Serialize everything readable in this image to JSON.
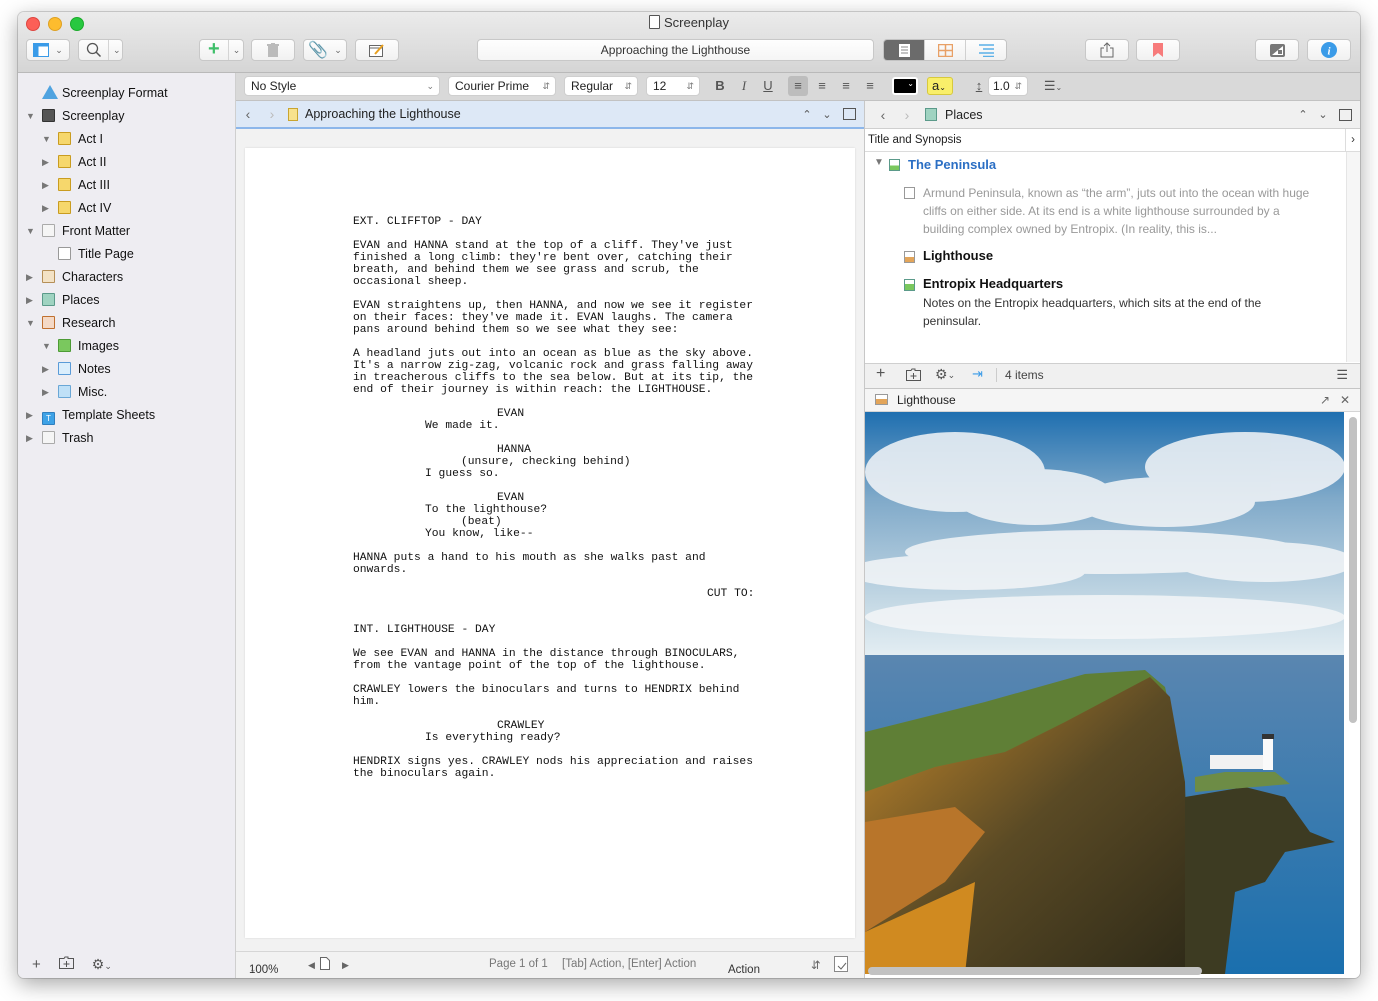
{
  "window": {
    "title": "Screenplay"
  },
  "toolbar": {
    "document_title": "Approaching the Lighthouse",
    "buttons": [
      "layout-button",
      "search-button",
      "add-button",
      "trash-button",
      "attach-button",
      "compose-button",
      "view-scrivenings",
      "view-corkboard",
      "view-outliner",
      "share-button",
      "bookmark-button",
      "compose-mode-button",
      "inspector-button"
    ],
    "colors": {
      "add": "#3fbf6a",
      "corkboard": "#e8a066",
      "outliner": "#5ab0e8",
      "bookmark": "#f77b7b",
      "inspector": "#3a9be8"
    }
  },
  "formatbar": {
    "style": "No Style",
    "font": "Courier Prime",
    "weight": "Regular",
    "size": "12",
    "bold": "B",
    "italic": "I",
    "underline": "U",
    "highlight_label": "a",
    "line_spacing": "1.0"
  },
  "binder": {
    "items": [
      {
        "label": "Screenplay Format",
        "level": 0,
        "icon": "warning-icon",
        "expander": "none"
      },
      {
        "label": "Screenplay",
        "level": 0,
        "icon": "screenplay-icon",
        "expander": "open"
      },
      {
        "label": "Act I",
        "level": 1,
        "icon": "book-icon",
        "expander": "open"
      },
      {
        "label": "Act II",
        "level": 1,
        "icon": "book-icon",
        "expander": "closed"
      },
      {
        "label": "Act III",
        "level": 1,
        "icon": "book-icon",
        "expander": "closed"
      },
      {
        "label": "Act IV",
        "level": 1,
        "icon": "book-icon",
        "expander": "closed"
      },
      {
        "label": "Front Matter",
        "level": 0,
        "icon": "front-matter-icon",
        "expander": "open"
      },
      {
        "label": "Title Page",
        "level": 1,
        "icon": "page-icon",
        "expander": "none"
      },
      {
        "label": "Characters",
        "level": 0,
        "icon": "characters-icon",
        "expander": "closed"
      },
      {
        "label": "Places",
        "level": 0,
        "icon": "places-icon",
        "expander": "closed"
      },
      {
        "label": "Research",
        "level": 0,
        "icon": "research-icon",
        "expander": "open"
      },
      {
        "label": "Images",
        "level": 1,
        "icon": "green-book-icon",
        "expander": "open"
      },
      {
        "label": "Notes",
        "level": 1,
        "icon": "notebook-icon",
        "expander": "closed"
      },
      {
        "label": "Misc.",
        "level": 1,
        "icon": "folder-icon",
        "expander": "closed"
      },
      {
        "label": "Template Sheets",
        "level": 0,
        "icon": "template-icon",
        "expander": "closed"
      },
      {
        "label": "Trash",
        "level": 0,
        "icon": "trash-icon",
        "expander": "closed"
      }
    ]
  },
  "editor": {
    "header_title": "Approaching the Lighthouse",
    "script": [
      {
        "type": "scene",
        "text": "EXT. CLIFFTOP - DAY"
      },
      {
        "type": "action",
        "text": "EVAN and HANNA stand at the top of a cliff. They've just\nfinished a long climb: they're bent over, catching their\nbreath, and behind them we see grass and scrub, the\noccasional sheep."
      },
      {
        "type": "action",
        "text": "EVAN straightens up, then HANNA, and now we see it register\non their faces: they've made it. EVAN laughs. The camera\npans around behind them so we see what they see:"
      },
      {
        "type": "action",
        "text": "A headland juts out into an ocean as blue as the sky above.\nIt's a narrow zig-zag, volcanic rock and grass falling away\nin treacherous cliffs to the sea below. But at its tip, the\nend of their journey is within reach: the LIGHTHOUSE."
      },
      {
        "type": "character",
        "text": "EVAN"
      },
      {
        "type": "dialogue",
        "text": "We made it."
      },
      {
        "type": "character",
        "text": "HANNA"
      },
      {
        "type": "parenthetical",
        "text": "(unsure, checking behind)"
      },
      {
        "type": "dialogue",
        "text": "I guess so."
      },
      {
        "type": "character",
        "text": "EVAN"
      },
      {
        "type": "dialogue",
        "text": "To the lighthouse?"
      },
      {
        "type": "parenthetical",
        "text": "(beat)"
      },
      {
        "type": "dialogue",
        "text": "You know, like--"
      },
      {
        "type": "action",
        "text": "HANNA puts a hand to his mouth as she walks past and\nonwards."
      },
      {
        "type": "transition",
        "text": "CUT TO:"
      },
      {
        "type": "scene",
        "text": "INT. LIGHTHOUSE - DAY"
      },
      {
        "type": "action",
        "text": "We see EVAN and HANNA in the distance through BINOCULARS,\nfrom the vantage point of the top of the lighthouse."
      },
      {
        "type": "action",
        "text": "CRAWLEY lowers the binoculars and turns to HENDRIX behind\nhim."
      },
      {
        "type": "character",
        "text": "CRAWLEY"
      },
      {
        "type": "dialogue",
        "text": "Is everything ready?"
      },
      {
        "type": "action",
        "text": "HENDRIX signs yes. CRAWLEY nods his appreciation and raises\nthe binoculars again."
      }
    ],
    "footer": {
      "zoom": "100%",
      "page_info": "Page 1 of 1",
      "element_hint": "[Tab] Action, [Enter] Action",
      "element_type": "Action"
    }
  },
  "outliner": {
    "header_title": "Places",
    "column_header": "Title and Synopsis",
    "rows": [
      {
        "title": "The Peninsula",
        "synopsis": "",
        "expanded": true,
        "highlight": true
      },
      {
        "title": "",
        "synopsis": "Armund Peninsula, known as “the arm”, juts out into the ocean with huge\ncliffs on either side. At its end is a white lighthouse surrounded by a\nbuilding complex owned by Entropix. (In reality, this is...",
        "child": true
      },
      {
        "title": "Lighthouse",
        "synopsis": ""
      },
      {
        "title": "Entropix Headquarters",
        "synopsis": "Notes on the Entropix headquarters, which sits at the end of the\npeninsular."
      }
    ],
    "item_count": "4 items"
  },
  "quick_ref": {
    "title": "Lighthouse",
    "image_description": "Sea cliff headland with white lighthouse under blue cloudy sky"
  }
}
